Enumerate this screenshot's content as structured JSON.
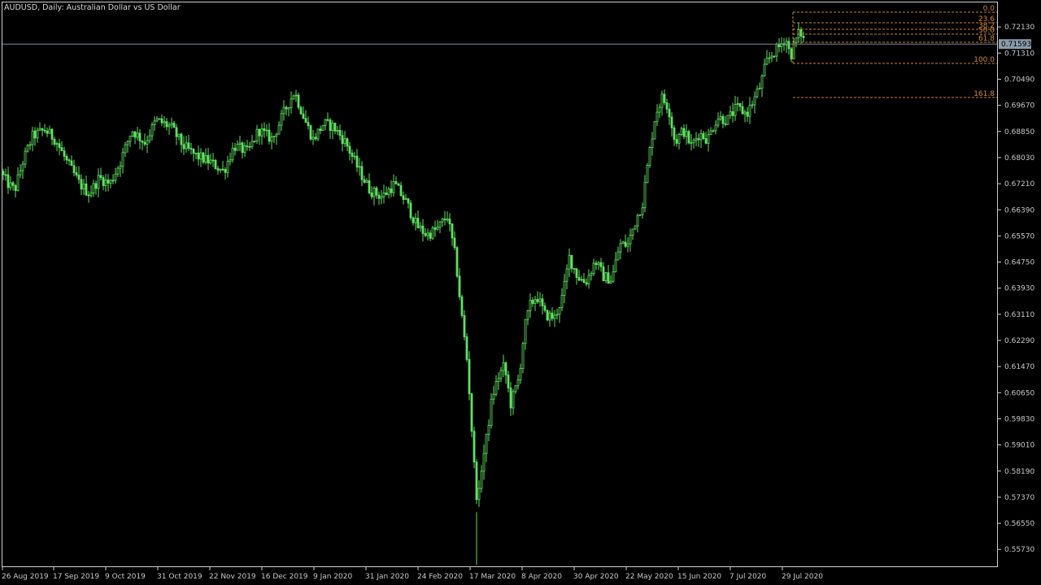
{
  "window": {
    "symbol_title": "AUDUSD, Daily:  Australian Dollar vs US Dollar"
  },
  "colors": {
    "background": "#000000",
    "candle": "#5fe060",
    "grid_frame": "#cfcfcf",
    "price_line": "#7a8aa0",
    "fibo": "#c8803a",
    "price_tag_bg": "#8a9aaa"
  },
  "current_price": {
    "label": "0.71593",
    "value": 0.71593
  },
  "chart_data": {
    "type": "candlestick",
    "title": "AUDUSD, Daily:  Australian Dollar vs US Dollar",
    "ylim": [
      0.552,
      0.729
    ],
    "y_ticks": [
      "0.72130",
      "0.71310",
      "0.70490",
      "0.69670",
      "0.68850",
      "0.68030",
      "0.67210",
      "0.66390",
      "0.65570",
      "0.64750",
      "0.63930",
      "0.63110",
      "0.62290",
      "0.61470",
      "0.60650",
      "0.59830",
      "0.59010",
      "0.58190",
      "0.57370",
      "0.56550",
      "0.55730"
    ],
    "x_labels": [
      "26 Aug 2019",
      "17 Sep 2019",
      "9 Oct 2019",
      "31 Oct 2019",
      "22 Nov 2019",
      "16 Dec 2019",
      "9 Jan 2020",
      "31 Jan 2020",
      "24 Feb 2020",
      "17 Mar 2020",
      "8 Apr 2020",
      "30 Apr 2020",
      "22 May 2020",
      "15 Jun 2020",
      "7 Jul 2020",
      "29 Jul 2020"
    ],
    "price_path": [
      [
        0,
        0.676
      ],
      [
        10,
        0.672
      ],
      [
        18,
        0.67
      ],
      [
        28,
        0.679
      ],
      [
        40,
        0.687
      ],
      [
        55,
        0.689
      ],
      [
        68,
        0.686
      ],
      [
        82,
        0.679
      ],
      [
        98,
        0.672
      ],
      [
        110,
        0.669
      ],
      [
        122,
        0.674
      ],
      [
        135,
        0.672
      ],
      [
        148,
        0.679
      ],
      [
        162,
        0.689
      ],
      [
        178,
        0.685
      ],
      [
        192,
        0.692
      ],
      [
        210,
        0.69
      ],
      [
        225,
        0.684
      ],
      [
        240,
        0.681
      ],
      [
        258,
        0.679
      ],
      [
        275,
        0.676
      ],
      [
        288,
        0.684
      ],
      [
        305,
        0.682
      ],
      [
        318,
        0.689
      ],
      [
        335,
        0.686
      ],
      [
        350,
        0.695
      ],
      [
        362,
        0.701
      ],
      [
        375,
        0.692
      ],
      [
        385,
        0.686
      ],
      [
        398,
        0.691
      ],
      [
        410,
        0.69
      ],
      [
        425,
        0.685
      ],
      [
        440,
        0.677
      ],
      [
        455,
        0.67
      ],
      [
        470,
        0.668
      ],
      [
        485,
        0.672
      ],
      [
        500,
        0.666
      ],
      [
        512,
        0.659
      ],
      [
        525,
        0.656
      ],
      [
        538,
        0.658
      ],
      [
        550,
        0.662
      ],
      [
        560,
        0.649
      ],
      [
        568,
        0.63
      ],
      [
        575,
        0.615
      ],
      [
        580,
        0.595
      ],
      [
        585,
        0.576
      ],
      [
        588,
        0.572
      ],
      [
        592,
        0.583
      ],
      [
        598,
        0.592
      ],
      [
        605,
        0.605
      ],
      [
        612,
        0.611
      ],
      [
        620,
        0.615
      ],
      [
        628,
        0.603
      ],
      [
        638,
        0.611
      ],
      [
        645,
        0.627
      ],
      [
        652,
        0.634
      ],
      [
        660,
        0.637
      ],
      [
        670,
        0.631
      ],
      [
        682,
        0.63
      ],
      [
        692,
        0.637
      ],
      [
        700,
        0.649
      ],
      [
        710,
        0.643
      ],
      [
        720,
        0.641
      ],
      [
        732,
        0.648
      ],
      [
        742,
        0.643
      ],
      [
        752,
        0.642
      ],
      [
        762,
        0.653
      ],
      [
        772,
        0.653
      ],
      [
        782,
        0.661
      ],
      [
        790,
        0.666
      ],
      [
        798,
        0.681
      ],
      [
        806,
        0.694
      ],
      [
        814,
        0.699
      ],
      [
        822,
        0.696
      ],
      [
        830,
        0.685
      ],
      [
        840,
        0.689
      ],
      [
        850,
        0.684
      ],
      [
        860,
        0.688
      ],
      [
        870,
        0.686
      ],
      [
        882,
        0.693
      ],
      [
        894,
        0.692
      ],
      [
        906,
        0.696
      ],
      [
        918,
        0.694
      ],
      [
        928,
        0.699
      ],
      [
        935,
        0.703
      ],
      [
        942,
        0.71
      ],
      [
        950,
        0.713
      ],
      [
        958,
        0.715
      ],
      [
        966,
        0.718
      ],
      [
        972,
        0.712
      ],
      [
        978,
        0.717
      ],
      [
        984,
        0.72
      ],
      [
        990,
        0.716
      ]
    ],
    "fibonacci": {
      "levels": [
        {
          "label": "0.0",
          "value": 0.7242
        },
        {
          "label": "23.6",
          "value": 0.722
        },
        {
          "label": "38.2",
          "value": 0.7206
        },
        {
          "label": "50.0",
          "value": 0.7194
        },
        {
          "label": "61.8",
          "value": 0.7183
        },
        {
          "label": "100.0",
          "value": 0.7147
        },
        {
          "label": "161.8",
          "value": 0.7089
        }
      ]
    }
  }
}
